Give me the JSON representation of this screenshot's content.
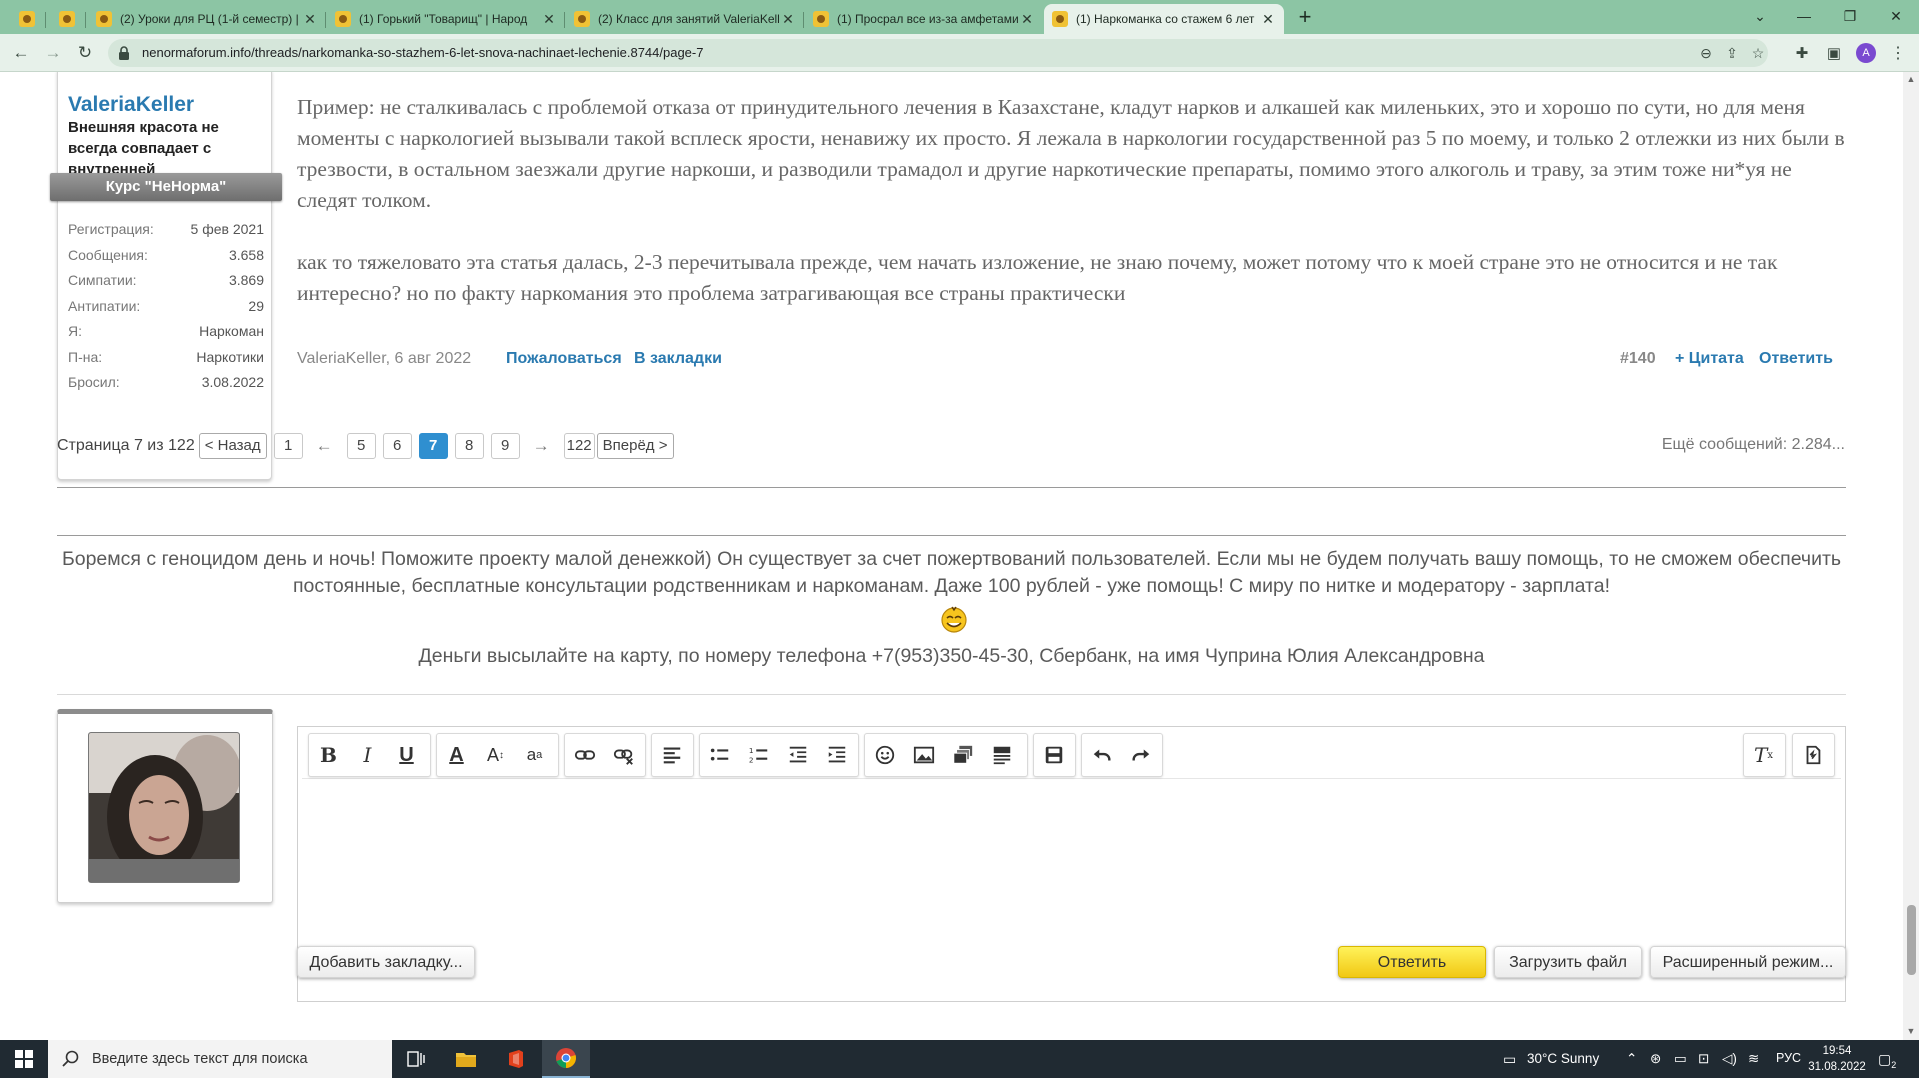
{
  "browser": {
    "tabs": [
      {
        "title": "",
        "pinned": true
      },
      {
        "title": "",
        "pinned": true
      },
      {
        "title": "(2) Уроки для РЦ (1-й семестр) |"
      },
      {
        "title": "(1) Горький \"Товарищ\" | Народ"
      },
      {
        "title": "(2) Класс для занятий ValeriaKell"
      },
      {
        "title": "(1) Просрал все из-за амфетами"
      },
      {
        "title": "(1) Наркоманка со стажем 6 лет",
        "active": true
      }
    ],
    "new_tab": "+",
    "url": "nenormaforum.info/threads/narkomanka-so-stazhem-6-let-snova-nachinaet-lechenie.8744/page-7",
    "profile_initial": "A"
  },
  "user": {
    "name": "ValeriaKeller",
    "title": "Внешняя красота не всегда совпадает с внутренней",
    "rank": "Курс \"НеНорма\"",
    "stats": [
      {
        "label": "Регистрация:",
        "value": "5 фев 2021"
      },
      {
        "label": "Сообщения:",
        "value": "3.658"
      },
      {
        "label": "Симпатии:",
        "value": "3.869"
      },
      {
        "label": "Антипатии:",
        "value": "29"
      },
      {
        "label": "Я:",
        "value": "Наркоман"
      },
      {
        "label": "П-на:",
        "value": "Наркотики"
      },
      {
        "label": "Бросил:",
        "value": "3.08.2022"
      }
    ]
  },
  "message": {
    "paragraphs": [
      "Пример: не сталкивалась с проблемой отказа от принудительного лечения в Казахстане, кладут нарков и алкашей как миленьких, это и хорошо по сути, но для меня моменты с наркологией вызывали такой всплеск ярости, ненавижу их просто. Я лежала в наркологии государственной раз 5 по моему, и только 2 отлежки из них были в трезвости, в остальном заезжали другие наркоши, и разводили трамадол и другие наркотические препараты, помимо этого алкоголь и траву, за этим тоже ни*уя не следят толком.",
      "как то тяжеловато эта статья далась, 2-3 перечитывала прежде, чем начать изложение, не знаю почему, может потому что к моей стране это не относится и не так интересно? но по факту наркомания это проблема затрагивающая все страны практически"
    ],
    "author_date": "ValeriaKeller, 6 авг 2022",
    "report": "Пожаловаться",
    "bookmark": "В закладки",
    "post_number": "#140",
    "quote": "+ Цитата",
    "reply": "Ответить"
  },
  "pagination": {
    "label": "Страница 7 из 122",
    "prev": "< Назад",
    "first": "1",
    "left_arrow": "←",
    "pages": [
      "5",
      "6",
      "7",
      "8",
      "9"
    ],
    "current": "7",
    "right_arrow": "→",
    "last": "122",
    "next": "Вперёд >",
    "more": "Ещё сообщений: 2.284..."
  },
  "donation": {
    "text": "Боремся с геноцидом день и ночь! Поможите проекту малой денежкой) Он существует за счет пожертвований пользователей. Если мы не будем получать вашу помощь, то не сможем обеспечить постоянные, бесплатные консультации родственникам и наркоманам. Даже 100 рублей - уже помощь! С миру по нитке и модератору - зарплата!",
    "card": "Деньги высылайте на карту, по номеру телефона +7(953)350-45-30, Сбербанк, на имя Чуприна Юлия Александровна"
  },
  "editor": {
    "buttons": {
      "add_bookmark": "Добавить закладку...",
      "reply": "Ответить",
      "upload": "Загрузить файл",
      "advanced": "Расширенный режим..."
    }
  },
  "taskbar": {
    "search_placeholder": "Введите здесь текст для поиска",
    "weather": "30°C  Sunny",
    "lang": "РУС",
    "time": "19:54",
    "date": "31.08.2022",
    "notifications": "2"
  },
  "colors": {
    "tab_strip": "#8cc5a4",
    "link": "#2a7ab0",
    "current_page": "#2f8fd0",
    "reply_button": "#f5d62c"
  }
}
